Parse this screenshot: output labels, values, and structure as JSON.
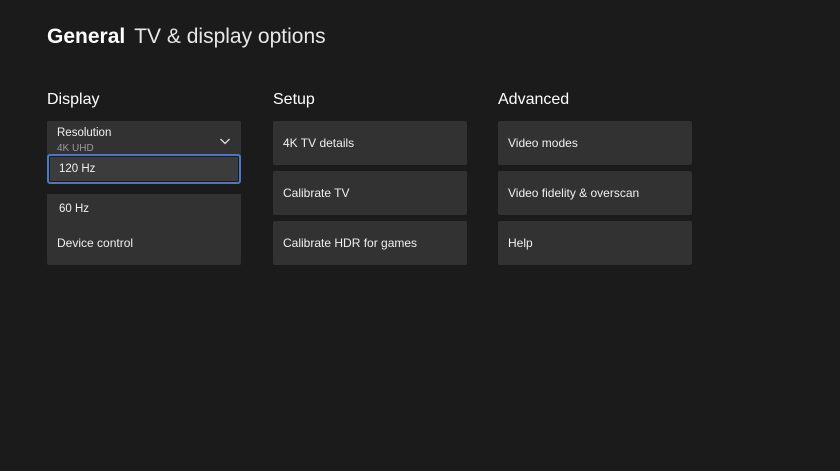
{
  "header": {
    "section": "General",
    "title": "TV & display options"
  },
  "display": {
    "heading": "Display",
    "resolution": {
      "label": "Resolution",
      "value": "4K UHD",
      "icon": "chevron-down-icon"
    },
    "refresh_options": [
      "120 Hz",
      "60 Hz"
    ],
    "device_control": "Device control"
  },
  "setup": {
    "heading": "Setup",
    "items": [
      "4K TV details",
      "Calibrate TV",
      "Calibrate HDR for games"
    ]
  },
  "advanced": {
    "heading": "Advanced",
    "items": [
      "Video modes",
      "Video fidelity & overscan",
      "Help"
    ]
  },
  "colors": {
    "background": "#1b1b1b",
    "tile": "#323232",
    "focus_border": "#4a78c8"
  }
}
